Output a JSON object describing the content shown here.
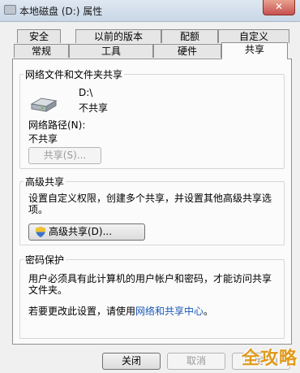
{
  "window": {
    "title": "本地磁盘 (D:) 属性",
    "close_glyph": "✕"
  },
  "tabs": {
    "back": [
      "安全",
      "以前的版本",
      "配额",
      "自定义"
    ],
    "front": [
      "常规",
      "工具",
      "硬件",
      "共享"
    ],
    "active": "共享"
  },
  "network_sharing": {
    "title": "网络文件和文件夹共享",
    "drive_name": "D:\\",
    "drive_status": "不共享",
    "path_label": "网络路径(N):",
    "path_value": "不共享",
    "share_button": "共享(S)..."
  },
  "advanced_sharing": {
    "title": "高级共享",
    "description_line1": "设置自定义权限，创建多个共享，并设置其他高级共享选",
    "description_line2": "项。",
    "button": "高级共享(D)..."
  },
  "password_protection": {
    "title": "密码保护",
    "line1": "用户必须具有此计算机的用户帐户和密码，才能访问共享",
    "line2": "文件夹。",
    "change_prefix": "若要更改此设置，请使用",
    "change_link": "网络和共享中心",
    "change_suffix": "。"
  },
  "footer": {
    "close_button": "关闭",
    "cancel_button": "取消",
    "apply_button": "应用(A)"
  },
  "watermark": "全攻略",
  "colors": {
    "link": "#1a58b6",
    "watermark": "#e09a1c",
    "close_button": "#c75050"
  }
}
